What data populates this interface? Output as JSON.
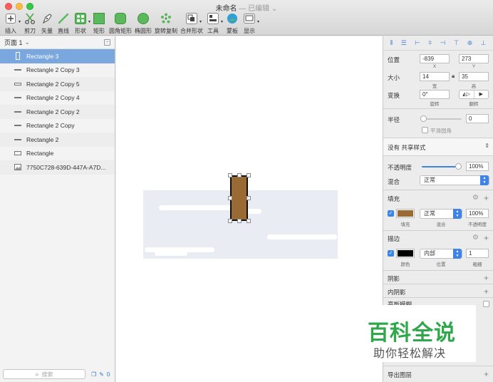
{
  "window": {
    "title": "未命名",
    "subtitle": "— 已编辑"
  },
  "toolbar": {
    "items": [
      {
        "label": "插入",
        "icon": "plus-icon"
      },
      {
        "label": "剪刀",
        "icon": "scissors-icon"
      },
      {
        "label": "矢量",
        "icon": "pen-icon"
      },
      {
        "label": "直线",
        "icon": "line-icon"
      },
      {
        "label": "形状",
        "icon": "shapes-icon"
      },
      {
        "label": "矩形",
        "icon": "rectangle-icon"
      },
      {
        "label": "圆角矩形",
        "icon": "rounded-rectangle-icon"
      },
      {
        "label": "椭圆形",
        "icon": "oval-icon"
      },
      {
        "label": "旋转复制",
        "icon": "rotate-copy-icon"
      },
      {
        "label": "合并形状",
        "icon": "combine-icon"
      },
      {
        "label": "工具",
        "icon": "tools-icon"
      },
      {
        "label": "蒙板",
        "icon": "mask-icon"
      },
      {
        "label": "显示",
        "icon": "view-icon"
      }
    ],
    "accent": "#5cb85c"
  },
  "layers": {
    "page": "页面 1",
    "items": [
      {
        "name": "Rectangle 3",
        "icon": "vertical-rect-icon",
        "selected": true
      },
      {
        "name": "Rectangle 2 Copy 3",
        "icon": "line-layer-icon"
      },
      {
        "name": "Rectangle 2 Copy 5",
        "icon": "line-layer-icon"
      },
      {
        "name": "Rectangle 2 Copy 4",
        "icon": "line-layer-icon"
      },
      {
        "name": "Rectangle 2 Copy 2",
        "icon": "line-layer-icon"
      },
      {
        "name": "Rectangle 2 Copy",
        "icon": "line-layer-icon"
      },
      {
        "name": "Rectangle 2",
        "icon": "line-layer-icon"
      },
      {
        "name": "Rectangle",
        "icon": "rect-layer-icon"
      },
      {
        "name": "7750C728-639D-447A-A7D...",
        "icon": "image-layer-icon"
      }
    ],
    "search_placeholder": "搜索",
    "bottom_count": "0"
  },
  "inspector": {
    "position_label": "位置",
    "x": "-839",
    "y": "273",
    "x_label": "X",
    "y_label": "Y",
    "size_label": "大小",
    "width": "14",
    "height": "35",
    "width_label": "宽",
    "height_label": "高",
    "transform_label": "变换",
    "rotation": "0°",
    "rotate_label": "旋转",
    "flip_label": "翻转",
    "radius_label": "半径",
    "radius_value": "0",
    "smooth_corners": "平滑圆角",
    "shared_style": "没有 共享样式",
    "opacity_label": "不透明度",
    "opacity_value": "100%",
    "blend_label": "混合",
    "blend_value": "正常",
    "fill_title": "填充",
    "fill_color": "#9a6a34",
    "fill_blend": "正常",
    "fill_opacity": "100%",
    "fill_sub": "填充",
    "fill_blend_sub": "混合",
    "fill_opacity_sub": "不透明度",
    "border_title": "描边",
    "border_color": "#000000",
    "border_position": "内部",
    "border_width": "1",
    "border_color_sub": "颜色",
    "border_position_sub": "位置",
    "border_width_sub": "粗细",
    "shadow_title": "阴影",
    "inner_shadow_title": "内阴影",
    "blur_title": "高斯模糊",
    "export_title": "导出图层"
  },
  "watermark": {
    "main": "百科全说",
    "sub": "助你轻松解决"
  }
}
